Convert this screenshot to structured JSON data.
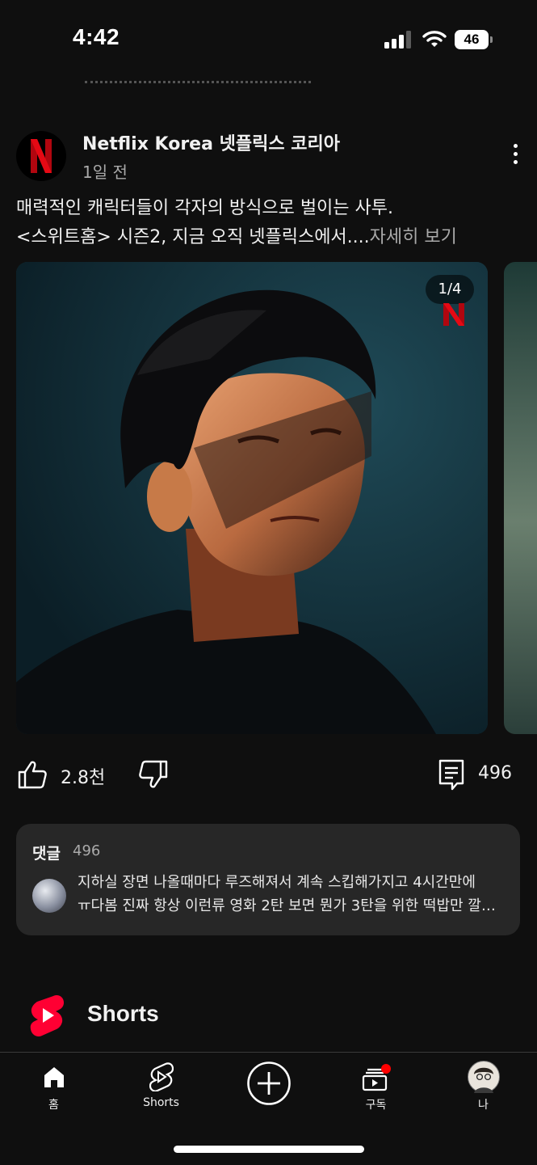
{
  "status_bar": {
    "time": "4:42",
    "battery": "46"
  },
  "post": {
    "channel_name": "Netflix Korea 넷플릭스 코리아",
    "time_ago": "1일 전",
    "text_line1": "매력적인 캐릭터들이 각자의 방식으로 벌이는 사투.",
    "text_line2": "<스위트홈> 시즌2, 지금 오직 넷플릭스에서....",
    "read_more": "자세히 보기",
    "image_indicator": "1/4",
    "like_count": "2.8천",
    "comment_count": "496"
  },
  "comments": {
    "title": "댓글",
    "count": "496",
    "top_comment_line1": "지하실 장면 나올때마다 루즈해져서 계속 스킵해가지고 4시간만에",
    "top_comment_line2": "ㅠ다봄 진짜 항상 이런류 영화 2탄 보면 뭔가 3탄을 위한 떡밥만 깔고 끝나는 느낌"
  },
  "shorts": {
    "title": "Shorts"
  },
  "nav": {
    "items": [
      {
        "label": "홈",
        "icon": "home-icon"
      },
      {
        "label": "Shorts",
        "icon": "shorts-icon"
      },
      {
        "label": "",
        "icon": "create-icon"
      },
      {
        "label": "구독",
        "icon": "subscriptions-icon"
      },
      {
        "label": "나",
        "icon": "avatar"
      }
    ]
  },
  "colors": {
    "background": "#0f0f0f",
    "card": "#272727",
    "accent_red": "#ff0000",
    "netflix_red": "#e50914"
  }
}
